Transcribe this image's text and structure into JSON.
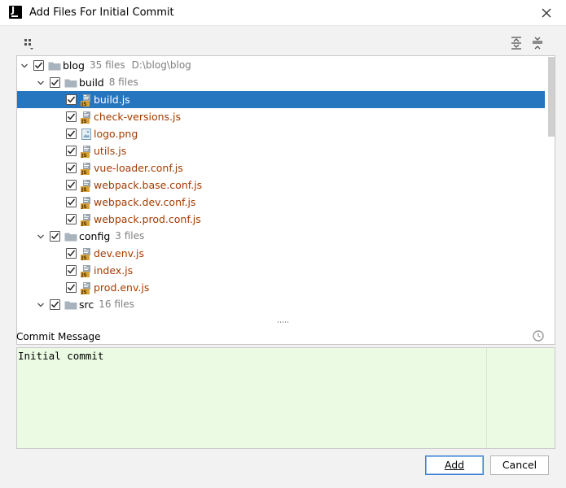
{
  "window": {
    "title": "Add Files For Initial Commit"
  },
  "tree": {
    "rows": [
      {
        "depth": 0,
        "kind": "dir",
        "expanded": true,
        "checked": true,
        "name": "blog",
        "count": "35 files",
        "path": "D:\\blog\\blog",
        "selected": false
      },
      {
        "depth": 1,
        "kind": "dir",
        "expanded": true,
        "checked": true,
        "name": "build",
        "count": "8 files",
        "path": "",
        "selected": false
      },
      {
        "depth": 2,
        "kind": "js",
        "checked": true,
        "name": "build.js",
        "selected": true
      },
      {
        "depth": 2,
        "kind": "js",
        "checked": true,
        "name": "check-versions.js",
        "selected": false
      },
      {
        "depth": 2,
        "kind": "png",
        "checked": true,
        "name": "logo.png",
        "selected": false
      },
      {
        "depth": 2,
        "kind": "js",
        "checked": true,
        "name": "utils.js",
        "selected": false
      },
      {
        "depth": 2,
        "kind": "js",
        "checked": true,
        "name": "vue-loader.conf.js",
        "selected": false
      },
      {
        "depth": 2,
        "kind": "js",
        "checked": true,
        "name": "webpack.base.conf.js",
        "selected": false
      },
      {
        "depth": 2,
        "kind": "js",
        "checked": true,
        "name": "webpack.dev.conf.js",
        "selected": false
      },
      {
        "depth": 2,
        "kind": "js",
        "checked": true,
        "name": "webpack.prod.conf.js",
        "selected": false
      },
      {
        "depth": 1,
        "kind": "dir",
        "expanded": true,
        "checked": true,
        "name": "config",
        "count": "3 files",
        "path": "",
        "selected": false
      },
      {
        "depth": 2,
        "kind": "js",
        "checked": true,
        "name": "dev.env.js",
        "selected": false
      },
      {
        "depth": 2,
        "kind": "js",
        "checked": true,
        "name": "index.js",
        "selected": false
      },
      {
        "depth": 2,
        "kind": "js",
        "checked": true,
        "name": "prod.env.js",
        "selected": false
      },
      {
        "depth": 1,
        "kind": "dir",
        "expanded": true,
        "checked": true,
        "name": "src",
        "count": "16 files",
        "path": "",
        "selected": false
      }
    ]
  },
  "commit": {
    "label": "Commit Message",
    "message": "Initial commit"
  },
  "buttons": {
    "add_label": "Add",
    "cancel_label": "Cancel"
  },
  "colors": {
    "selection": "#2675bf",
    "file_text": "#a43b00",
    "message_bg": "#ebfbe3"
  }
}
